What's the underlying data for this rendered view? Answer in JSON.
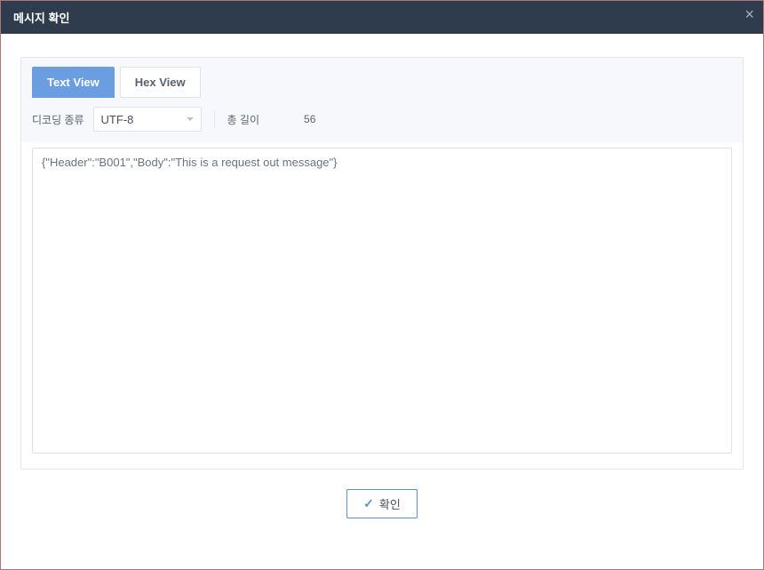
{
  "header": {
    "title": "메시지 확인"
  },
  "tabs": {
    "text_view": "Text View",
    "hex_view": "Hex View"
  },
  "controls": {
    "decoding_label": "디코딩 종류",
    "decoding_value": "UTF-8",
    "total_length_label": "총 길이",
    "total_length_value": "56"
  },
  "message": {
    "content": "{\"Header\":\"B001\",\"Body\":\"This is a request out message\"}"
  },
  "footer": {
    "confirm_label": "확인"
  }
}
